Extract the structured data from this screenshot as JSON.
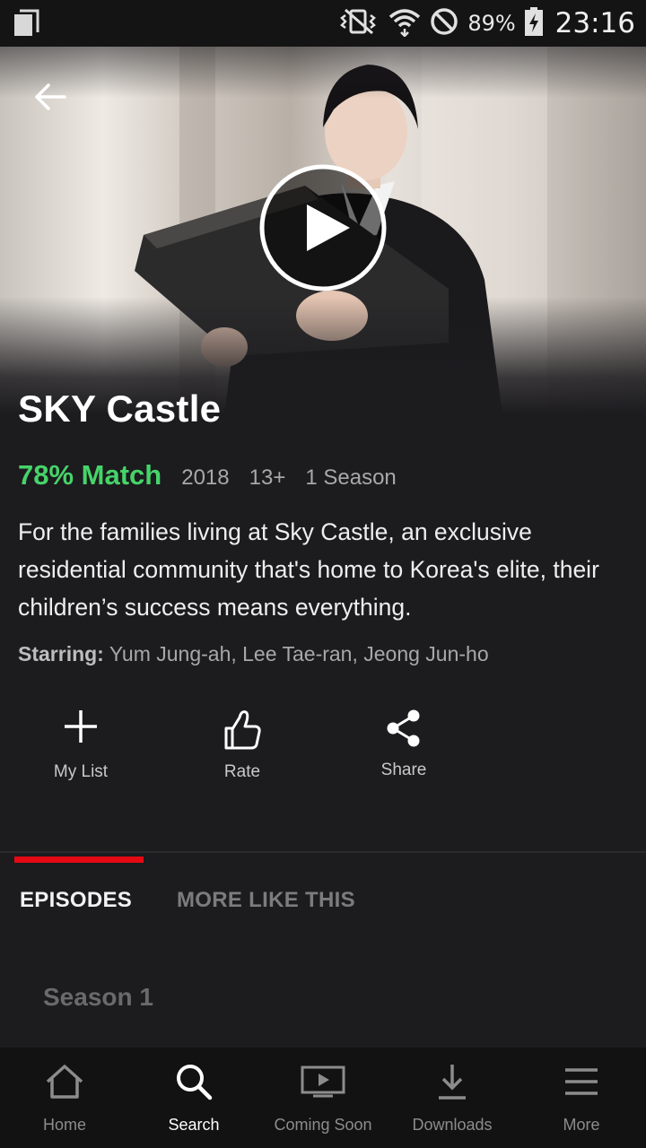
{
  "status_bar": {
    "battery": "89%",
    "time": "23:16"
  },
  "show": {
    "title": "SKY Castle",
    "match": "78% Match",
    "year": "2018",
    "rating": "13+",
    "seasons": "1 Season",
    "synopsis": "For the families living at Sky Castle, an exclusive residential community that's home to Korea's elite, their children’s success means everything.",
    "starring_label": "Starring:",
    "starring": "Yum Jung-ah, Lee Tae-ran, Jeong Jun-ho"
  },
  "actions": {
    "my_list": "My List",
    "rate": "Rate",
    "share": "Share"
  },
  "tabs": {
    "episodes": "EPISODES",
    "more_like_this": "MORE LIKE THIS"
  },
  "season_selector": "Season 1",
  "bottom_nav": {
    "home": "Home",
    "search": "Search",
    "coming_soon": "Coming Soon",
    "downloads": "Downloads",
    "more": "More"
  },
  "colors": {
    "match_green": "#46d369",
    "accent_red": "#e50914",
    "background": "#1c1b1e"
  }
}
